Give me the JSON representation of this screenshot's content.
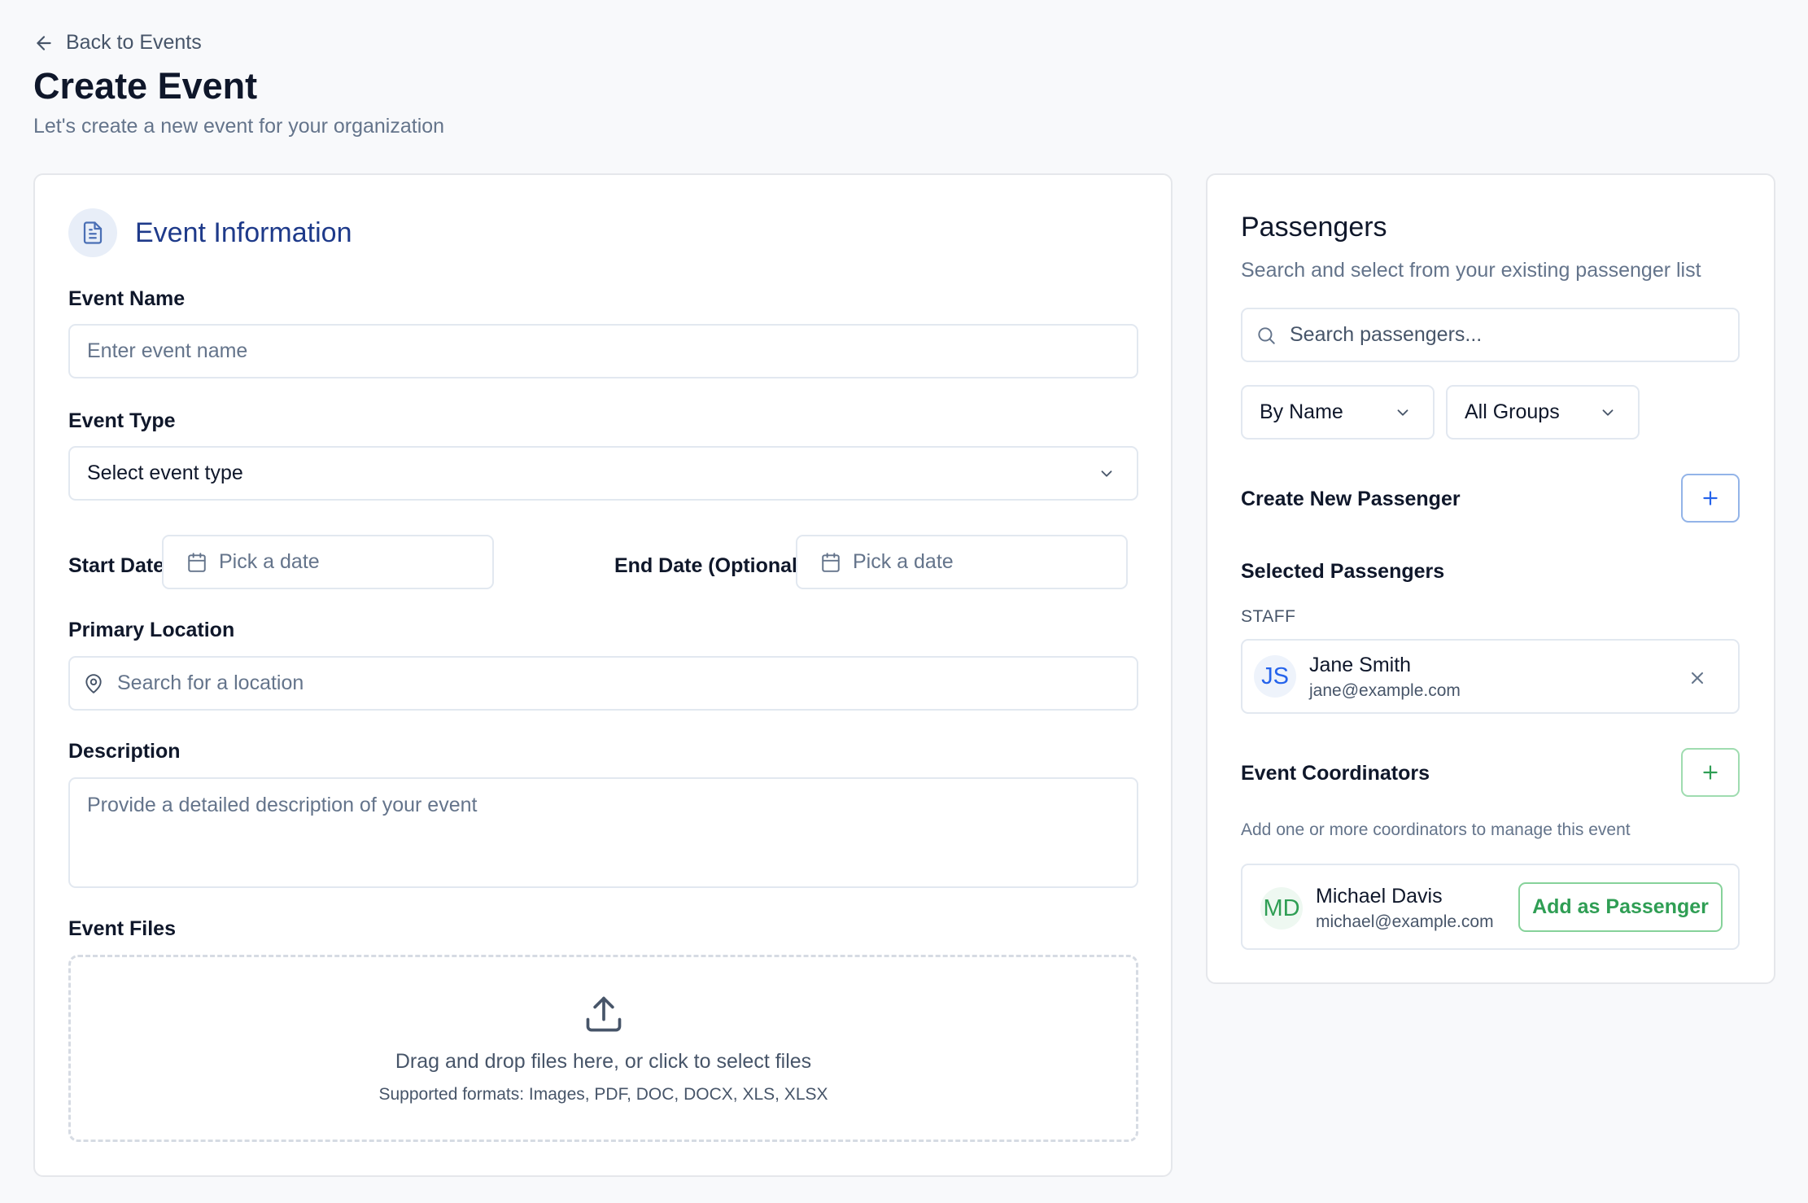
{
  "nav": {
    "back_label": "Back to Events"
  },
  "page": {
    "title": "Create Event",
    "subtitle": "Let's create a new event for your organization"
  },
  "event_info": {
    "title": "Event Information",
    "icon": "file-text-icon",
    "event_name": {
      "label": "Event Name",
      "placeholder": "Enter event name"
    },
    "event_type": {
      "label": "Event Type",
      "selected": "Select event type"
    },
    "start_date": {
      "label": "Start Date",
      "placeholder": "Pick a date"
    },
    "end_date": {
      "label": "End Date (Optional)",
      "placeholder": "Pick a date"
    },
    "location": {
      "label": "Primary Location",
      "placeholder": "Search for a location"
    },
    "description": {
      "label": "Description",
      "placeholder": "Provide a detailed description of your event"
    },
    "files": {
      "label": "Event Files",
      "drop_text": "Drag and drop files here, or click to select files",
      "formats_text": "Supported formats: Images, PDF, DOC, DOCX, XLS, XLSX"
    }
  },
  "passengers": {
    "title": "Passengers",
    "subtitle": "Search and select from your existing passenger list",
    "search_placeholder": "Search passengers...",
    "sort_select": "By Name",
    "group_select": "All Groups",
    "create_label": "Create New Passenger",
    "selected_label": "Selected Passengers",
    "group_heading": "STAFF",
    "selected": [
      {
        "initials": "JS",
        "name": "Jane Smith",
        "email": "jane@example.com"
      }
    ]
  },
  "coordinators": {
    "label": "Event Coordinators",
    "hint": "Add one or more coordinators to manage this event",
    "items": [
      {
        "initials": "MD",
        "name": "Michael Davis",
        "email": "michael@example.com",
        "action_label": "Add as Passenger"
      }
    ]
  },
  "colors": {
    "accent_blue": "#1e3a8a",
    "plus_blue": "#2563eb",
    "green": "#2f9e54",
    "background": "#f8f9fb"
  }
}
